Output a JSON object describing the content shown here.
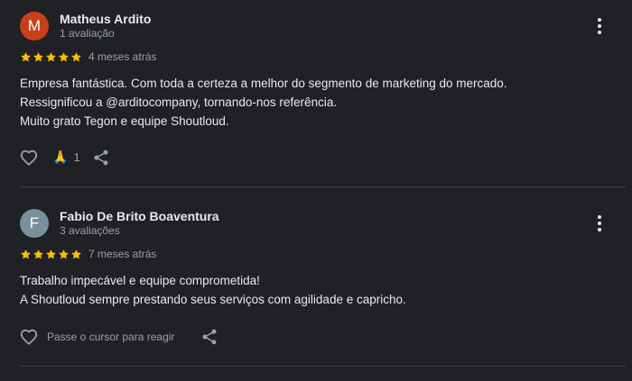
{
  "reviews": [
    {
      "avatar_letter": "M",
      "avatar_color": "#c5401b",
      "name": "Matheus Ardito",
      "reviews_count": "1 avaliação",
      "stars": 5,
      "date": "4 meses atrás",
      "text_lines": [
        "Empresa fantástica. Com toda a certeza a melhor do segmento de marketing do mercado.",
        "Ressignificou a @arditocompany, tornando-nos referência.",
        "Muito grato Tegon e equipe Shoutloud."
      ],
      "reaction_emoji": "🙏",
      "reaction_count": "1",
      "icons": [
        "heart-outline-icon",
        "share-icon",
        "more-vert-icon"
      ]
    },
    {
      "avatar_letter": "F",
      "avatar_color": "#78909c",
      "name": "Fabio De Brito Boaventura",
      "reviews_count": "3 avaliações",
      "stars": 5,
      "date": "7 meses atrás",
      "text_lines": [
        "Trabalho impecável e equipe comprometida!",
        "A Shoutloud sempre prestando seus serviços com agilidade e capricho."
      ],
      "react_hint": "Passe o cursor para reagir",
      "icons": [
        "heart-outline-icon",
        "share-icon",
        "more-vert-icon"
      ]
    }
  ],
  "colors": {
    "star": "#fbbc04",
    "background": "#202124",
    "text": "#e8eaed",
    "muted": "#9aa0a6"
  }
}
